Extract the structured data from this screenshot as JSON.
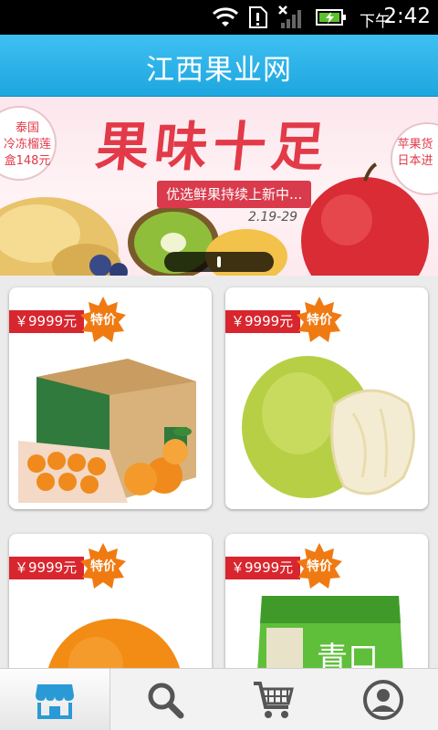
{
  "status_bar": {
    "ampm": "下午",
    "time": "2:42",
    "icons": [
      "wifi-icon",
      "sim-alert-icon",
      "signal-icon",
      "battery-charging-icon"
    ]
  },
  "header": {
    "title": "江西果业网"
  },
  "banner": {
    "headline": "果味十足",
    "subtitle": "优选鲜果持续上新中...",
    "date": "2.19-29",
    "left_bubble": [
      "泰国",
      "冷冻榴莲",
      "盒148元"
    ],
    "right_bubble": [
      "苹果货",
      "日本进"
    ]
  },
  "products": [
    {
      "price": "￥9999元",
      "badge": "特价",
      "image": "orange-gift-box-image"
    },
    {
      "price": "￥9999元",
      "badge": "特价",
      "image": "pomelo-image"
    },
    {
      "price": "￥9999元",
      "badge": "特价",
      "image": "navel-orange-image"
    },
    {
      "price": "￥9999元",
      "badge": "特价",
      "image": "green-plum-snack-image"
    }
  ],
  "bottom_nav": {
    "tabs": [
      {
        "icon": "store-icon",
        "active": true
      },
      {
        "icon": "search-icon",
        "active": false
      },
      {
        "icon": "cart-icon",
        "active": false
      },
      {
        "icon": "profile-icon",
        "active": false
      }
    ]
  },
  "colors": {
    "header_blue": "#1da6df",
    "price_red": "#d8262f",
    "badge_orange": "#f07a12",
    "nav_active": "#2a9ad6",
    "nav_inactive": "#555555"
  }
}
